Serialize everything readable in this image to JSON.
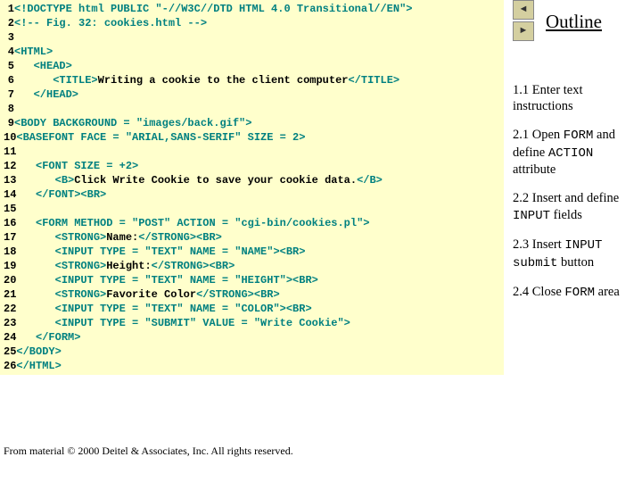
{
  "code": {
    "l1a": "1",
    "l1b": "<!DOCTYPE html PUBLIC \"-//W3C//DTD HTML 4.0 Transitional//EN\">",
    "l2a": "2",
    "l2b": "<!-- Fig. 32: cookies.html -->",
    "l3a": "3",
    "l4a": "4",
    "l4b": "<HTML>",
    "l5a": "5",
    "l5b": "   <HEAD>",
    "l6a": "6",
    "l6b": "      <TITLE>",
    "l6c": "Writing a cookie to the client computer",
    "l6d": "</TITLE>",
    "l7a": "7",
    "l7b": "   </HEAD>",
    "l8a": "8",
    "l9a": "9",
    "l9b": "<BODY BACKGROUND = \"images/back.gif\">",
    "l10a": "10",
    "l10b": "<BASEFONT FACE = \"ARIAL,SANS-SERIF\" SIZE = 2>",
    "l11a": "11",
    "l12a": "12",
    "l12b": "   <FONT SIZE = +2>",
    "l13a": "13",
    "l13b": "      <B>",
    "l13c": "Click Write Cookie to save your cookie data.",
    "l13d": "</B>",
    "l14a": "14",
    "l14b": "   </FONT><BR>",
    "l15a": "15",
    "l16a": "16",
    "l16b": "   <FORM METHOD = \"POST\" ACTION = \"cgi-bin/cookies.pl\">",
    "l17a": "17",
    "l17b": "      <STRONG>",
    "l17c": "Name:",
    "l17d": "</STRONG><BR>",
    "l18a": "18",
    "l18b": "      <INPUT TYPE = \"TEXT\" NAME = \"NAME\"><BR>",
    "l19a": "19",
    "l19b": "      <STRONG>",
    "l19c": "Height:",
    "l19d": "</STRONG><BR>",
    "l20a": "20",
    "l20b": "      <INPUT TYPE = \"TEXT\" NAME = \"HEIGHT\"><BR>",
    "l21a": "21",
    "l21b": "      <STRONG>",
    "l21c": "Favorite Color",
    "l21d": "</STRONG><BR>",
    "l22a": "22",
    "l22b": "      <INPUT TYPE = \"TEXT\" NAME = \"COLOR\"><BR>",
    "l23a": "23",
    "l23b": "      <INPUT TYPE = \"SUBMIT\" VALUE = \"Write Cookie\">",
    "l24a": "24",
    "l24b": "   </FORM>",
    "l25a": "25",
    "l25b": "</BODY>",
    "l26a": "26",
    "l26b": "</HTML>"
  },
  "outline": {
    "title": "Outline",
    "i1a": "1.1 Enter text instructions",
    "i2a": "2.1 Open ",
    "i2b": "FORM",
    "i2c": " and define ",
    "i2d": "ACTION",
    "i2e": " attribute",
    "i3a": "2.2 Insert and define ",
    "i3b": "INPUT",
    "i3c": " fields",
    "i4a": "2.3 Insert ",
    "i4b": "INPUT submit",
    "i4c": " button",
    "i5a": "2.4 Close ",
    "i5b": "FORM",
    "i5c": " area"
  },
  "footer": "From material © 2000 Deitel & Associates, Inc. All rights reserved."
}
